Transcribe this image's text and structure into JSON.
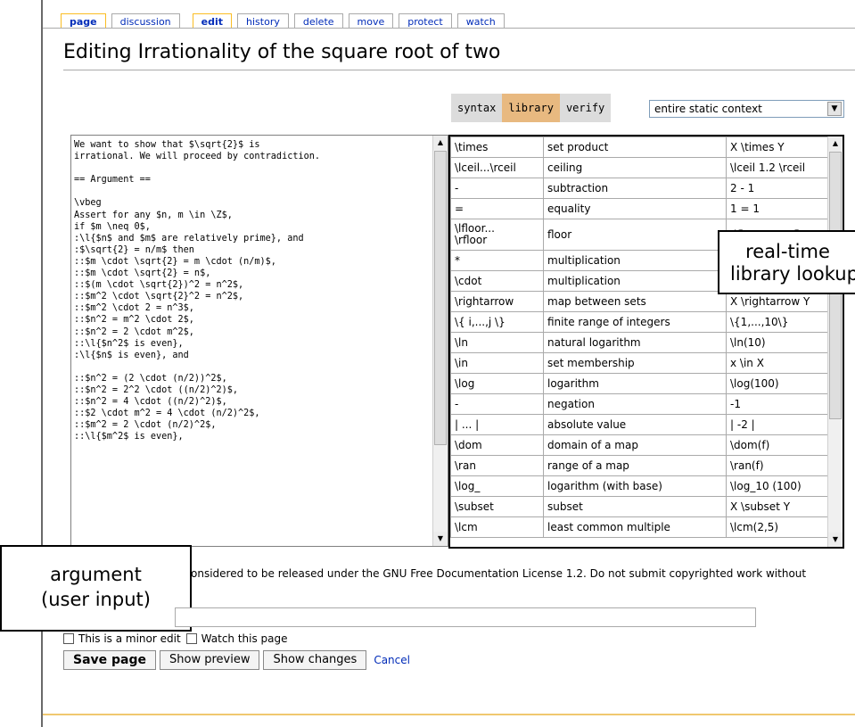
{
  "tabs": [
    {
      "label": "page",
      "selected": true
    },
    {
      "label": "discussion",
      "selected": false
    },
    {
      "label": "edit",
      "selected": true
    },
    {
      "label": "history",
      "selected": false
    },
    {
      "label": "delete",
      "selected": false
    },
    {
      "label": "move",
      "selected": false
    },
    {
      "label": "protect",
      "selected": false
    },
    {
      "label": "watch",
      "selected": false
    }
  ],
  "page_title": "Editing Irrationality of the square root of two",
  "library_toolbar": {
    "syntax": "syntax",
    "library": "library",
    "verify": "verify",
    "context_select": "entire static context"
  },
  "editor_text": "We want to show that $\\sqrt{2}$ is\nirrational. We will proceed by contradiction.\n\n== Argument ==\n\n\\vbeg\nAssert for any $n, m \\in \\Z$,\nif $m \\neq 0$,\n:\\l{$n$ and $m$ are relatively prime}, and\n:$\\sqrt{2} = n/m$ then\n::$m \\cdot \\sqrt{2} = m \\cdot (n/m)$,\n::$m \\cdot \\sqrt{2} = n$,\n::$(m \\cdot \\sqrt{2})^2 = n^2$,\n::$m^2 \\cdot \\sqrt{2}^2 = n^2$,\n::$m^2 \\cdot 2 = n^3$,\n::$n^2 = m^2 \\cdot 2$,\n::$n^2 = 2 \\cdot m^2$,\n::\\l{$n^2$ is even},\n:\\l{$n$ is even}, and\n\n::$n^2 = (2 \\cdot (n/2))^2$,\n::$n^2 = 2^2 \\cdot ((n/2)^2)$,\n::$n^2 = 4 \\cdot ((n/2)^2)$,\n::$2 \\cdot m^2 = 4 \\cdot (n/2)^2$,\n::$m^2 = 2 \\cdot (n/2)^2$,\n::\\l{$m^2$ is even},",
  "library_rows": [
    {
      "symbol": "\\times",
      "description": "set product",
      "example": "X \\times Y"
    },
    {
      "symbol": "\\lceil...\\rceil",
      "description": "ceiling",
      "example": "\\lceil 1.2 \\rceil"
    },
    {
      "symbol": "-",
      "description": "subtraction",
      "example": "2 - 1"
    },
    {
      "symbol": "=",
      "description": "equality",
      "example": "1 = 1"
    },
    {
      "symbol": "\\lfloor...\n\\rfloor",
      "description": "floor",
      "example": "\\lfloor 1.2 \\rfloor"
    },
    {
      "symbol": "*",
      "description": "multiplication",
      "example": ""
    },
    {
      "symbol": "\\cdot",
      "description": "multiplication",
      "example": ""
    },
    {
      "symbol": "\\rightarrow",
      "description": "map between sets",
      "example": "X \\rightarrow Y"
    },
    {
      "symbol": "\\{ i,...,j \\}",
      "description": "finite range of integers",
      "example": "\\{1,...,10\\}"
    },
    {
      "symbol": "\\ln",
      "description": "natural logarithm",
      "example": "\\ln(10)"
    },
    {
      "symbol": "\\in",
      "description": "set membership",
      "example": "x \\in X"
    },
    {
      "symbol": "\\log",
      "description": "logarithm",
      "example": "\\log(100)"
    },
    {
      "symbol": "-",
      "description": "negation",
      "example": "-1"
    },
    {
      "symbol": "| ... |",
      "description": "absolute value",
      "example": "| -2 |"
    },
    {
      "symbol": "\\dom",
      "description": "domain of a map",
      "example": "\\dom(f)"
    },
    {
      "symbol": "\\ran",
      "description": "range of a map",
      "example": "\\ran(f)"
    },
    {
      "symbol": "\\log_",
      "description": "logarithm (with base)",
      "example": "\\log_10 (100)"
    },
    {
      "symbol": "\\subset",
      "description": "subset",
      "example": "X \\subset Y"
    },
    {
      "symbol": "\\lcm",
      "description": "least common multiple",
      "example": "\\lcm(2,5)"
    }
  ],
  "callouts": {
    "realtime_line1": "real-time",
    "realtime_line2": "library lookup",
    "argument_line1": "argument",
    "argument_line2": "(user input)"
  },
  "license_text": "onsidered to be released under the GNU Free Documentation License 1.2. Do not submit copyrighted work without",
  "checkboxes": {
    "minor_edit": "This is a minor edit",
    "watch_page": "Watch this page"
  },
  "buttons": {
    "save": "Save page",
    "preview": "Show preview",
    "changes": "Show changes",
    "cancel": "Cancel"
  }
}
